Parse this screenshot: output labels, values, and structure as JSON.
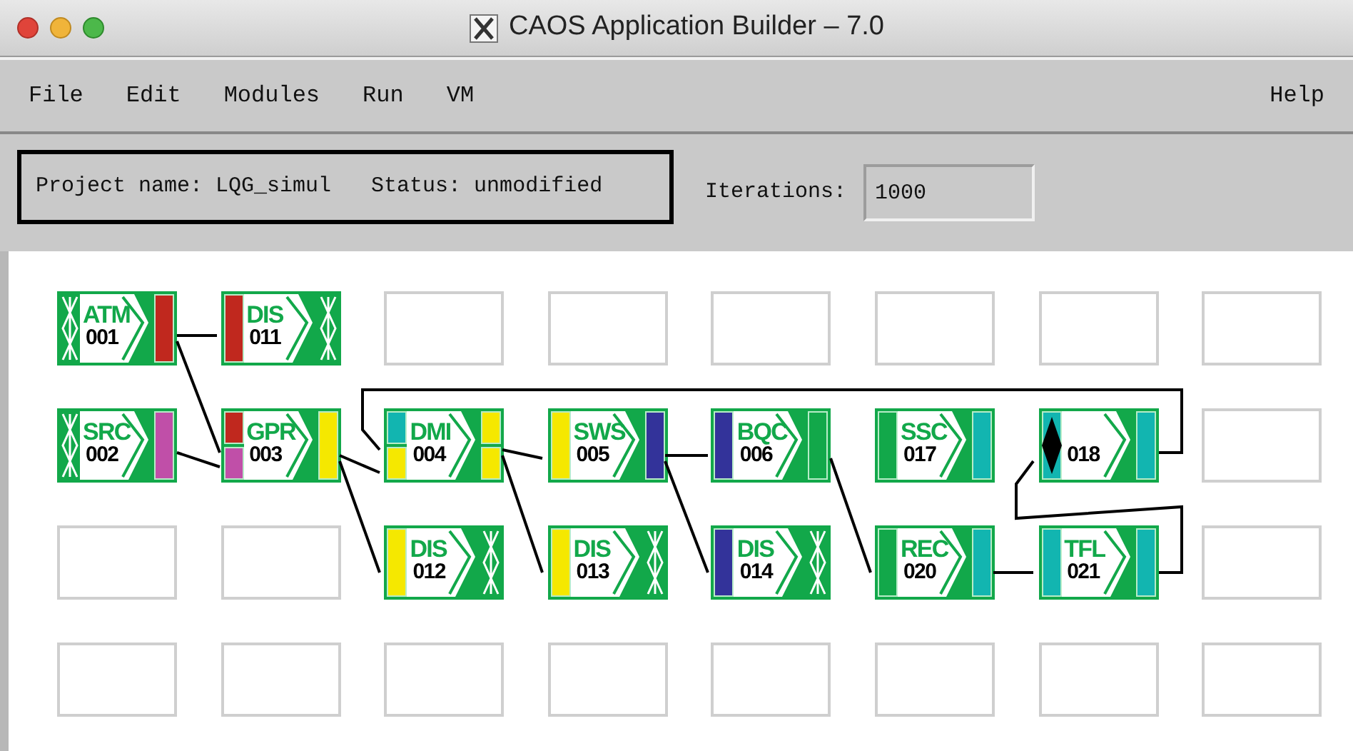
{
  "window": {
    "title": "CAOS Application Builder – 7.0"
  },
  "menu": {
    "items": [
      "File",
      "Edit",
      "Modules",
      "Run",
      "VM"
    ],
    "help": "Help"
  },
  "project": {
    "name": "Project name: LQG_simul",
    "status": "Status: unmodified"
  },
  "iterations": {
    "label": "Iterations:",
    "value": "1000"
  },
  "grid": [
    [
      {
        "kind": "module",
        "name": "ATM",
        "number": "001",
        "loop": false,
        "outputs": [
          {
            "color": "#c0281e"
          }
        ]
      },
      {
        "kind": "module",
        "name": "DIS",
        "number": "011",
        "loop": false,
        "inputs": [
          {
            "color": "#c0281e"
          }
        ]
      },
      {
        "kind": "empty"
      },
      {
        "kind": "empty"
      },
      {
        "kind": "empty"
      },
      {
        "kind": "empty"
      },
      {
        "kind": "empty"
      },
      {
        "kind": "empty"
      }
    ],
    [
      {
        "kind": "module",
        "name": "SRC",
        "number": "002",
        "loop": false,
        "outputs": [
          {
            "color": "#c04fa8"
          }
        ]
      },
      {
        "kind": "module",
        "name": "GPR",
        "number": "003",
        "loop": false,
        "inputs": [
          {
            "color": "#c0281e"
          },
          {
            "color": "#c04fa8"
          }
        ],
        "outputs": [
          {
            "color": "#f5e800"
          }
        ]
      },
      {
        "kind": "module",
        "name": "DMI",
        "number": "004",
        "loop": false,
        "inputs": [
          {
            "color": "#12b5b0"
          },
          {
            "color": "#f5e800"
          }
        ],
        "outputs": [
          {
            "color": "#f5e800"
          },
          {
            "color": "#f5e800"
          }
        ]
      },
      {
        "kind": "module",
        "name": "SWS",
        "number": "005",
        "loop": false,
        "inputs": [
          {
            "color": "#f5e800"
          }
        ],
        "outputs": [
          {
            "color": "#33339a"
          }
        ]
      },
      {
        "kind": "module",
        "name": "BQC",
        "number": "006",
        "loop": false,
        "inputs": [
          {
            "color": "#33339a"
          }
        ],
        "outputs": [
          {
            "color": "#12a84a"
          }
        ]
      },
      {
        "kind": "module",
        "name": "SSC",
        "number": "017",
        "loop": false,
        "inputs": [
          {
            "color": "#12a84a"
          }
        ],
        "outputs": [
          {
            "color": "#12b5b0"
          }
        ]
      },
      {
        "kind": "module",
        "number": "018",
        "loop": true,
        "inputs": [
          {
            "color": "#12b5b0"
          }
        ],
        "outputs": [
          {
            "color": "#12b5b0"
          }
        ]
      },
      {
        "kind": "empty"
      }
    ],
    [
      {
        "kind": "empty"
      },
      {
        "kind": "empty"
      },
      {
        "kind": "module",
        "name": "DIS",
        "number": "012",
        "loop": false,
        "inputs": [
          {
            "color": "#f5e800"
          }
        ]
      },
      {
        "kind": "module",
        "name": "DIS",
        "number": "013",
        "loop": false,
        "inputs": [
          {
            "color": "#f5e800"
          }
        ]
      },
      {
        "kind": "module",
        "name": "DIS",
        "number": "014",
        "loop": false,
        "inputs": [
          {
            "color": "#33339a"
          }
        ]
      },
      {
        "kind": "module",
        "name": "REC",
        "number": "020",
        "loop": false,
        "inputs": [
          {
            "color": "#12a84a"
          }
        ],
        "outputs": [
          {
            "color": "#12b5b0"
          }
        ]
      },
      {
        "kind": "module",
        "name": "TFL",
        "number": "021",
        "loop": false,
        "inputs": [
          {
            "color": "#12b5b0"
          }
        ],
        "outputs": [
          {
            "color": "#12b5b0"
          }
        ]
      },
      {
        "kind": "empty"
      }
    ],
    [
      {
        "kind": "empty"
      },
      {
        "kind": "empty"
      },
      {
        "kind": "empty"
      },
      {
        "kind": "empty"
      },
      {
        "kind": "empty"
      },
      {
        "kind": "empty"
      },
      {
        "kind": "empty"
      },
      {
        "kind": "empty"
      }
    ]
  ]
}
